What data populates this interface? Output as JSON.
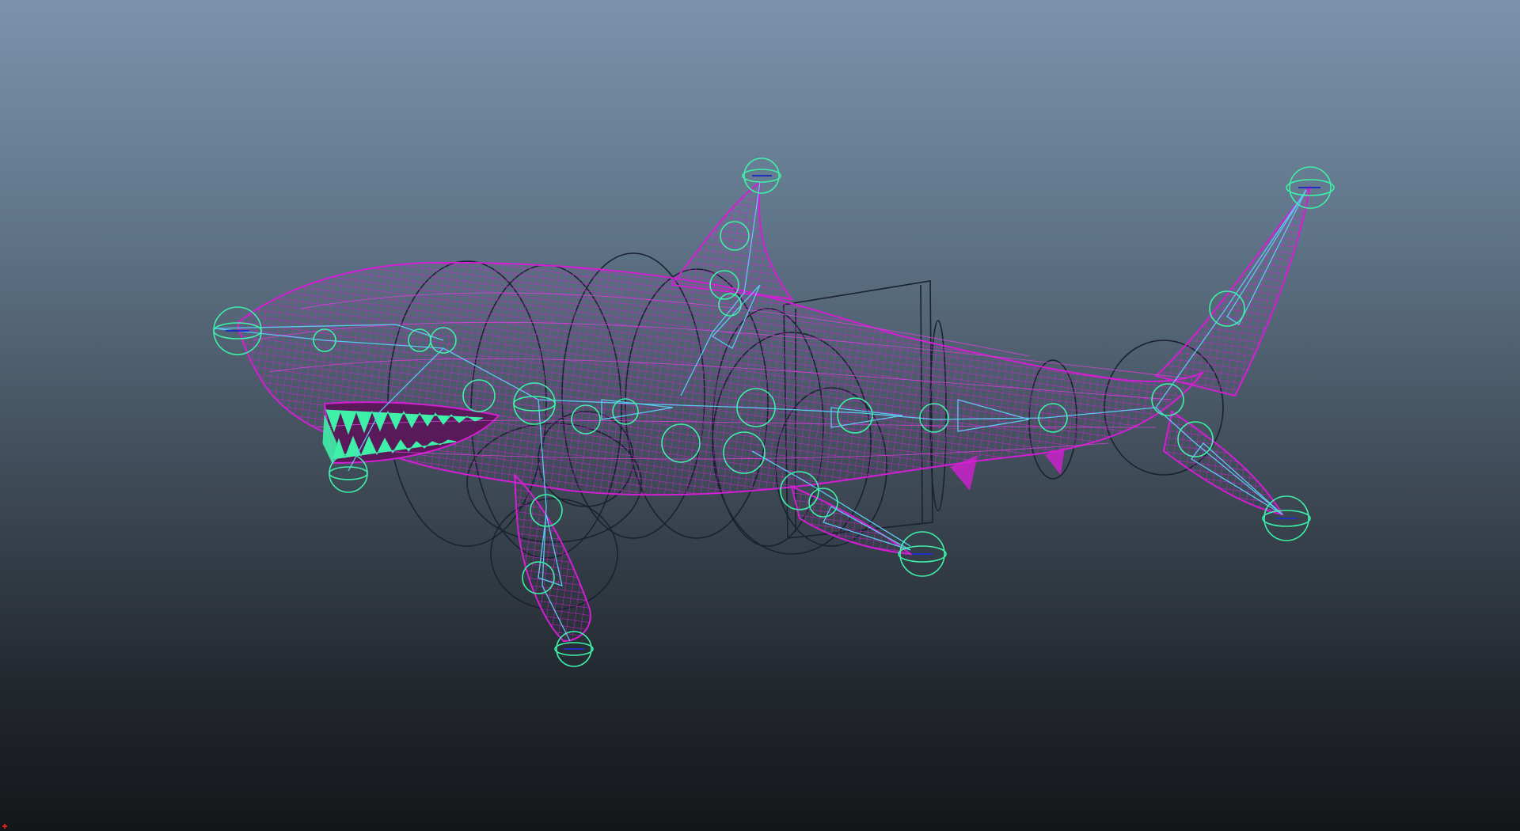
{
  "viewport": {
    "camera": "side",
    "display_mode": "wireframe",
    "background_top": "#7b93ac",
    "background_bottom": "#141619"
  },
  "colors": {
    "mesh_wireframe": "#d41ed4",
    "joint_controls": "#3ef0a8",
    "bone_lines": "#5cc8f0",
    "nurbs_curves": "#1a2230",
    "axis_x": "#e02020"
  },
  "model": {
    "name_icon": "shark-rig-icon"
  }
}
